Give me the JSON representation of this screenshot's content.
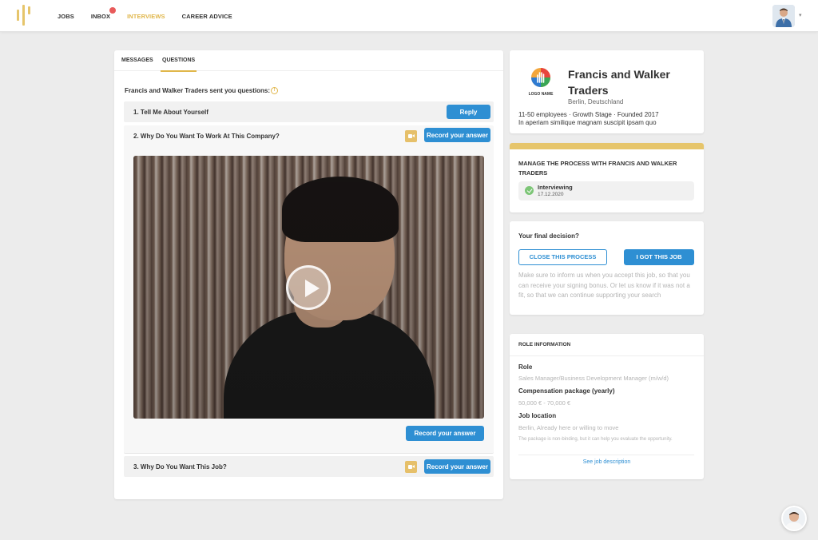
{
  "nav": {
    "items": [
      {
        "label": "JOBS"
      },
      {
        "label": "INBOX"
      },
      {
        "label": "INTERVIEWS"
      },
      {
        "label": "CAREER ADVICE"
      }
    ],
    "active": "INTERVIEWS"
  },
  "tabs": [
    {
      "label": "MESSAGES"
    },
    {
      "label": "QUESTIONS"
    }
  ],
  "intro": "Francis and Walker Traders sent you questions:",
  "questions": [
    {
      "title": "1. Tell Me About Yourself",
      "action": "Reply"
    },
    {
      "title": "2. Why Do You Want To Work At This Company?",
      "action": "Record your answer"
    },
    {
      "title": "3. Why Do You Want This Job?",
      "action": "Record your answer"
    }
  ],
  "video_record_label": "Record your answer",
  "company": {
    "name": "Francis and Walker Traders",
    "location": "Berlin, Deutschland",
    "meta": "11-50 employees  ·  Growth Stage  ·  Founded 2017",
    "description": "In aperiam similique magnam suscipit ipsam quo",
    "logo_text": "LOGO NAME"
  },
  "manage": {
    "title": "MANAGE THE PROCESS WITH FRANCIS AND WALKER TRADERS",
    "status": "Interviewing",
    "date": "17.12.2020"
  },
  "decision": {
    "title": "Your final decision?",
    "close_label": "CLOSE THIS PROCESS",
    "got_label": "I GOT THIS JOB",
    "note": "Make sure to inform us when you accept this job, so that you can receive your signing bonus. Or let us know if it was not a fit, so that we can continue supporting your search"
  },
  "role": {
    "header": "ROLE INFORMATION",
    "role_label": "Role",
    "role_value": "Sales Manager/Business Development Manager (m/w/d)",
    "comp_label": "Compensation package (yearly)",
    "comp_value": "50,000 € - 70,000 €",
    "location_label": "Job location",
    "location_value": "Berlin, Already here or willing to move",
    "note": "The package is non-binding, but it can help you evaluate the opportunity.",
    "link": "See job description"
  },
  "colors": {
    "accent": "#e0b64a",
    "primary": "#2e8fd3",
    "success": "#7cc576"
  }
}
